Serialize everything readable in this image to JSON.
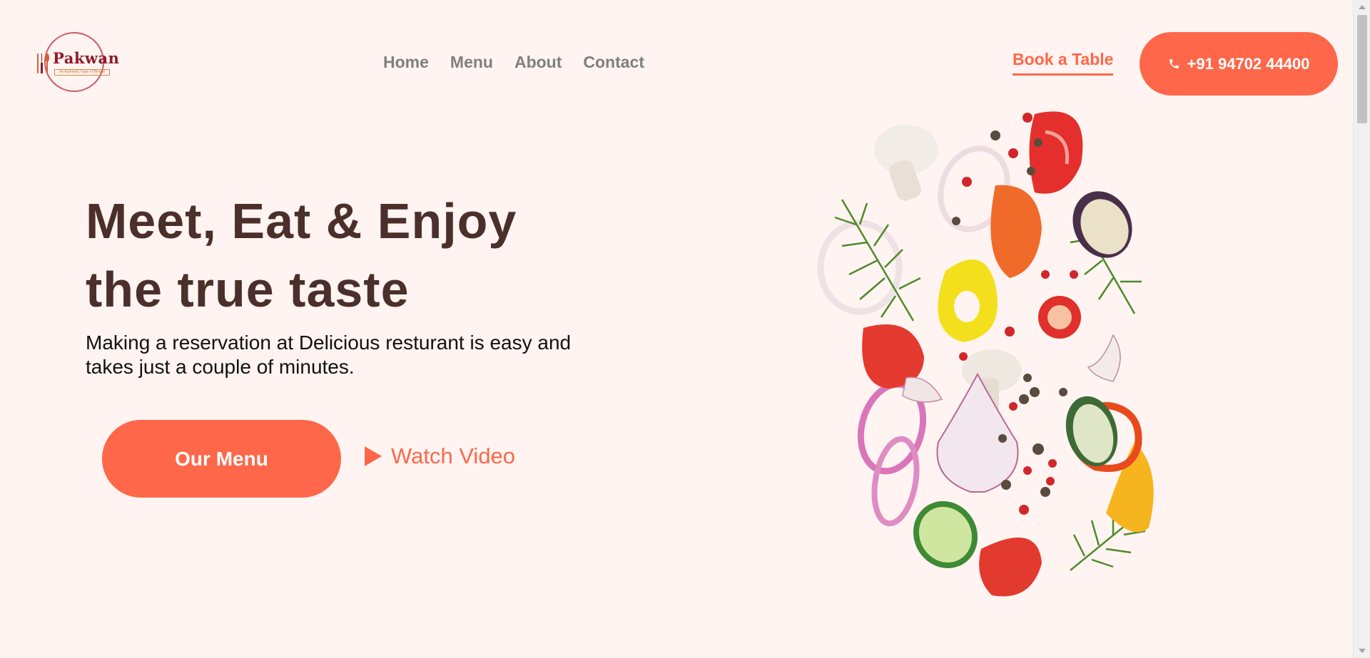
{
  "brand": {
    "logo_text": "Pakwan",
    "logo_tagline": "An Authentic Taste of Bengal",
    "colors": {
      "accent": "#fe6749",
      "heading": "#4b2f2a",
      "background": "#fff4f1",
      "nav": "#7f7f7f"
    }
  },
  "nav": {
    "items": [
      {
        "label": "Home"
      },
      {
        "label": "Menu"
      },
      {
        "label": "About"
      },
      {
        "label": "Contact"
      }
    ]
  },
  "header": {
    "book_label": "Book a Table",
    "phone_label": "+91 94702 44400",
    "phone_icon": "phone-icon"
  },
  "hero": {
    "title_line1": "Meet, Eat & Enjoy",
    "title_line2": "the true taste",
    "description": "Making a reservation at Delicious resturant is easy and takes just a couple of minutes.",
    "menu_button": "Our Menu",
    "watch_label": "Watch Video",
    "watch_icon": "play-icon"
  },
  "illustration": {
    "icon": "flying-vegetables-illustration"
  }
}
